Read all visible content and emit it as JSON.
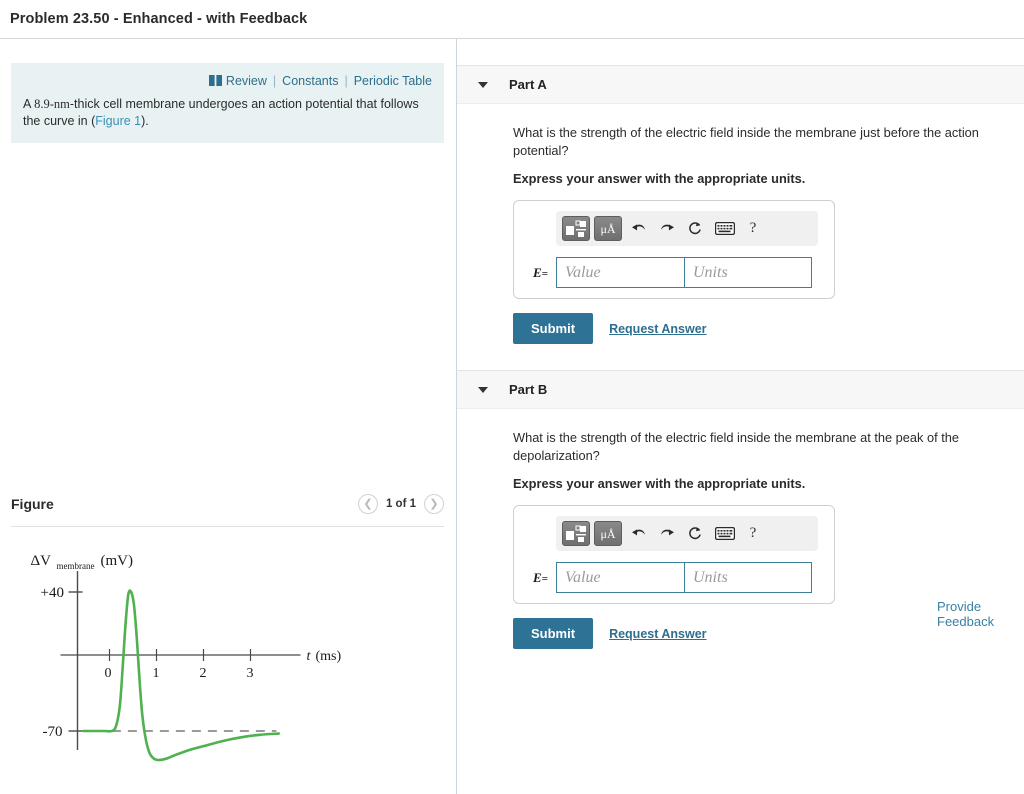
{
  "header": {
    "title": "Problem 23.50 - Enhanced - with Feedback"
  },
  "problem": {
    "resources": {
      "review_icon": "book-icon",
      "review": "Review",
      "separator": "|",
      "constants": "Constants",
      "periodic_table": "Periodic Table"
    },
    "text_prefix": "A ",
    "measurement": "8.9-nm",
    "text_middle": "-thick cell membrane undergoes an action potential that follows the curve in (",
    "figure_link": "Figure 1",
    "text_suffix": ")."
  },
  "figure": {
    "label": "Figure",
    "counter": "1 of 1",
    "prev_icon": "chevron-left-icon",
    "next_icon": "chevron-right-icon"
  },
  "chart_data": {
    "type": "line",
    "title": "",
    "ylabel": "ΔV_membrane (mV)",
    "ylabel_main": "ΔV",
    "ylabel_sub": "membrane",
    "ylabel_unit": "(mV)",
    "xlabel": "t (ms)",
    "xlabel_var": "t",
    "xlabel_unit": "(ms)",
    "x_ticks": [
      "0",
      "1",
      "2",
      "3"
    ],
    "x_tick_values": [
      0,
      1,
      2,
      3
    ],
    "y_ticks": [
      "+40",
      "-70"
    ],
    "y_tick_values": [
      40,
      -70
    ],
    "xlim": [
      -0.55,
      3.75
    ],
    "ylim": [
      -105,
      55
    ],
    "grid": false,
    "legend": false,
    "resting_potential": -70,
    "peak_potential": 40,
    "series": [
      {
        "name": "action potential",
        "color": "#4fb14f",
        "x": [
          -0.55,
          -0.3,
          -0.1,
          0.05,
          0.14,
          0.22,
          0.28,
          0.34,
          0.4,
          0.46,
          0.52,
          0.58,
          0.64,
          0.7,
          0.78,
          0.86,
          0.95,
          1.05,
          1.2,
          1.4,
          1.7,
          2.0,
          2.4,
          2.8,
          3.2,
          3.6
        ],
        "y": [
          -70,
          -70,
          -70,
          -70,
          -66,
          -50,
          -20,
          14,
          38,
          40,
          30,
          4,
          -30,
          -58,
          -78,
          -88,
          -92,
          -93,
          -92,
          -89,
          -85,
          -82,
          -78,
          -75,
          -73,
          -72
        ]
      },
      {
        "name": "resting baseline",
        "color": "#9a9a9a",
        "style": "dashed",
        "x": [
          0.05,
          3.55
        ],
        "y": [
          -70,
          -70
        ]
      }
    ]
  },
  "parts": [
    {
      "id": "part-a",
      "caret_icon": "chevron-down-icon",
      "title": "Part A",
      "question": "What is the strength of the electric field inside the membrane just before the action potential?",
      "express": "Express your answer with the appropriate units.",
      "toolbar": {
        "template_icon": "math-template-icon",
        "units_icon": "micro-angstrom-icon",
        "units_label": "μÅ",
        "undo_icon": "undo-arrow-icon",
        "undo_glyph": "↶",
        "redo_icon": "redo-arrow-icon",
        "redo_glyph": "↷",
        "reset_icon": "reset-circle-icon",
        "reset_glyph": "↻",
        "keyboard_icon": "keyboard-icon",
        "help_icon": "help-question-icon",
        "help_glyph": "?"
      },
      "entry": {
        "prefix_var": "E",
        "prefix_eq": "=",
        "value": "",
        "value_placeholder": "Value",
        "units": "",
        "units_placeholder": "Units"
      },
      "submit_label": "Submit",
      "request_label": "Request Answer"
    },
    {
      "id": "part-b",
      "caret_icon": "chevron-down-icon",
      "title": "Part B",
      "question": "What is the strength of the electric field inside the membrane at the peak of the depolarization?",
      "express": "Express your answer with the appropriate units.",
      "toolbar": {
        "template_icon": "math-template-icon",
        "units_icon": "micro-angstrom-icon",
        "units_label": "μÅ",
        "undo_icon": "undo-arrow-icon",
        "undo_glyph": "↶",
        "redo_icon": "redo-arrow-icon",
        "redo_glyph": "↷",
        "reset_icon": "reset-circle-icon",
        "reset_glyph": "↻",
        "keyboard_icon": "keyboard-icon",
        "help_icon": "help-question-icon",
        "help_glyph": "?"
      },
      "entry": {
        "prefix_var": "E",
        "prefix_eq": "=",
        "value": "",
        "value_placeholder": "Value",
        "units": "",
        "units_placeholder": "Units"
      },
      "submit_label": "Submit",
      "request_label": "Request Answer"
    }
  ],
  "footer": {
    "provide_feedback": "Provide Feedback"
  },
  "colors": {
    "accent_link": "#2d6f8e",
    "submit_bg": "#2e7296",
    "problem_bg": "#e9f2f3",
    "curve_green": "#4fb14f",
    "input_border": "#3d7f98"
  }
}
